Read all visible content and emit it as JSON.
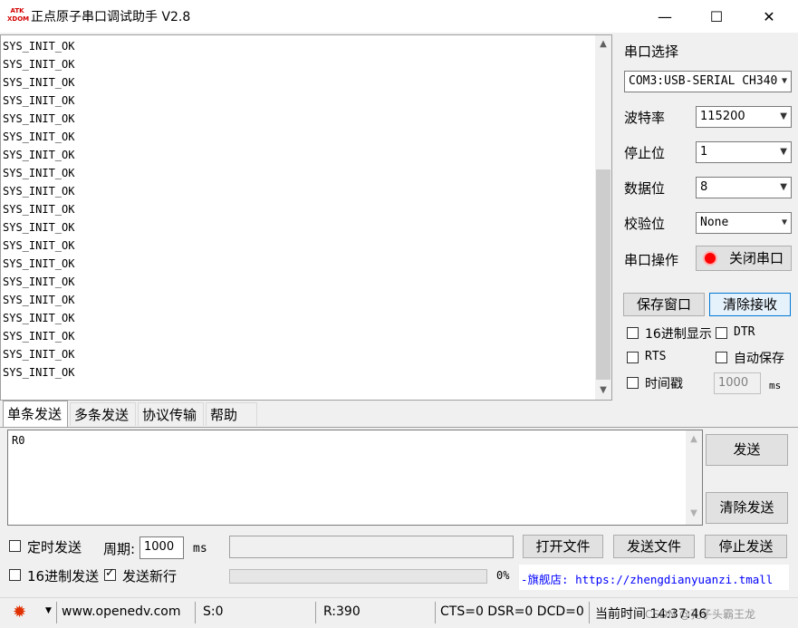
{
  "window": {
    "logo_text": "ATK\nXDOM",
    "title": "正点原子串口调试助手 V2.8",
    "minimize": "—",
    "maximize": "☐",
    "close": "✕"
  },
  "receive": {
    "lines": [
      "SYS_INIT_OK",
      "SYS_INIT_OK",
      "SYS_INIT_OK",
      "SYS_INIT_OK",
      "SYS_INIT_OK",
      "SYS_INIT_OK",
      "SYS_INIT_OK",
      "SYS_INIT_OK",
      "SYS_INIT_OK",
      "SYS_INIT_OK",
      "SYS_INIT_OK",
      "SYS_INIT_OK",
      "SYS_INIT_OK",
      "SYS_INIT_OK",
      "SYS_INIT_OK",
      "SYS_INIT_OK",
      "SYS_INIT_OK",
      "SYS_INIT_OK",
      "SYS_INIT_OK"
    ]
  },
  "settings": {
    "port_select_label": "串口选择",
    "port_value": "COM3:USB-SERIAL CH340",
    "baud_label": "波特率",
    "baud_value": "115200",
    "stop_label": "停止位",
    "stop_value": "1",
    "data_label": "数据位",
    "data_value": "8",
    "parity_label": "校验位",
    "parity_value": "None",
    "op_label": "串口操作",
    "close_port_button": "关闭串口",
    "save_window_button": "保存窗口",
    "clear_receive_button": "清除接收",
    "hex_display_label": "16进制显示",
    "dtr_label": "DTR",
    "rts_label": "RTS",
    "auto_save_label": "自动保存",
    "timestamp_label": "时间戳",
    "timestamp_value": "1000",
    "timestamp_unit": "ms"
  },
  "tabs": [
    "单条发送",
    "多条发送",
    "协议传输",
    "帮助"
  ],
  "send": {
    "text": "R0",
    "send_button": "发送",
    "clear_send_button": "清除发送",
    "timed_send_label": "定时发送",
    "period_label": "周期:",
    "period_value": "1000",
    "period_unit": "ms",
    "file_path": "",
    "open_file_button": "打开文件",
    "send_file_button": "发送文件",
    "stop_send_button": "停止发送",
    "hex_send_label": "16进制发送",
    "newline_label": "发送新行",
    "newline_checked": true,
    "progress_text": "0%",
    "shop_link": "-旗舰店: https://zhengdianyuanzi.tmall"
  },
  "status": {
    "website": "www.openedv.com",
    "sent": "S:0",
    "received": "R:390",
    "lines": "CTS=0 DSR=0 DCD=0",
    "time": "当前时间 14:37:46",
    "watermark": "CSDN @孔子头霸王龙"
  },
  "colors": {
    "accent": "#0078d7",
    "status_led": "#ff0000",
    "link": "#0000ff"
  }
}
